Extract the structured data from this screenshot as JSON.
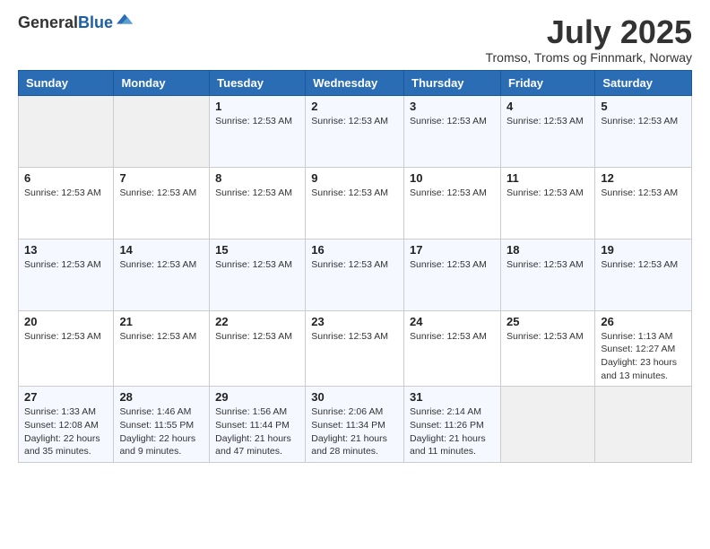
{
  "logo": {
    "general": "General",
    "blue": "Blue"
  },
  "header": {
    "month_year": "July 2025",
    "location": "Tromso, Troms og Finnmark, Norway"
  },
  "days_of_week": [
    "Sunday",
    "Monday",
    "Tuesday",
    "Wednesday",
    "Thursday",
    "Friday",
    "Saturday"
  ],
  "weeks": [
    [
      {
        "day": "",
        "info": ""
      },
      {
        "day": "",
        "info": ""
      },
      {
        "day": "1",
        "info": "Sunrise: 12:53 AM"
      },
      {
        "day": "2",
        "info": "Sunrise: 12:53 AM"
      },
      {
        "day": "3",
        "info": "Sunrise: 12:53 AM"
      },
      {
        "day": "4",
        "info": "Sunrise: 12:53 AM"
      },
      {
        "day": "5",
        "info": "Sunrise: 12:53 AM"
      }
    ],
    [
      {
        "day": "6",
        "info": "Sunrise: 12:53 AM"
      },
      {
        "day": "7",
        "info": "Sunrise: 12:53 AM"
      },
      {
        "day": "8",
        "info": "Sunrise: 12:53 AM"
      },
      {
        "day": "9",
        "info": "Sunrise: 12:53 AM"
      },
      {
        "day": "10",
        "info": "Sunrise: 12:53 AM"
      },
      {
        "day": "11",
        "info": "Sunrise: 12:53 AM"
      },
      {
        "day": "12",
        "info": "Sunrise: 12:53 AM"
      }
    ],
    [
      {
        "day": "13",
        "info": "Sunrise: 12:53 AM"
      },
      {
        "day": "14",
        "info": "Sunrise: 12:53 AM"
      },
      {
        "day": "15",
        "info": "Sunrise: 12:53 AM"
      },
      {
        "day": "16",
        "info": "Sunrise: 12:53 AM"
      },
      {
        "day": "17",
        "info": "Sunrise: 12:53 AM"
      },
      {
        "day": "18",
        "info": "Sunrise: 12:53 AM"
      },
      {
        "day": "19",
        "info": "Sunrise: 12:53 AM"
      }
    ],
    [
      {
        "day": "20",
        "info": "Sunrise: 12:53 AM"
      },
      {
        "day": "21",
        "info": "Sunrise: 12:53 AM"
      },
      {
        "day": "22",
        "info": "Sunrise: 12:53 AM"
      },
      {
        "day": "23",
        "info": "Sunrise: 12:53 AM"
      },
      {
        "day": "24",
        "info": "Sunrise: 12:53 AM"
      },
      {
        "day": "25",
        "info": "Sunrise: 12:53 AM"
      },
      {
        "day": "26",
        "info": "Sunrise: 1:13 AM\nSunset: 12:27 AM\nDaylight: 23 hours and 13 minutes."
      }
    ],
    [
      {
        "day": "27",
        "info": "Sunrise: 1:33 AM\nSunset: 12:08 AM\nDaylight: 22 hours and 35 minutes."
      },
      {
        "day": "28",
        "info": "Sunrise: 1:46 AM\nSunset: 11:55 PM\nDaylight: 22 hours and 9 minutes."
      },
      {
        "day": "29",
        "info": "Sunrise: 1:56 AM\nSunset: 11:44 PM\nDaylight: 21 hours and 47 minutes."
      },
      {
        "day": "30",
        "info": "Sunrise: 2:06 AM\nSunset: 11:34 PM\nDaylight: 21 hours and 28 minutes."
      },
      {
        "day": "31",
        "info": "Sunrise: 2:14 AM\nSunset: 11:26 PM\nDaylight: 21 hours and 11 minutes."
      },
      {
        "day": "",
        "info": ""
      },
      {
        "day": "",
        "info": ""
      }
    ]
  ]
}
